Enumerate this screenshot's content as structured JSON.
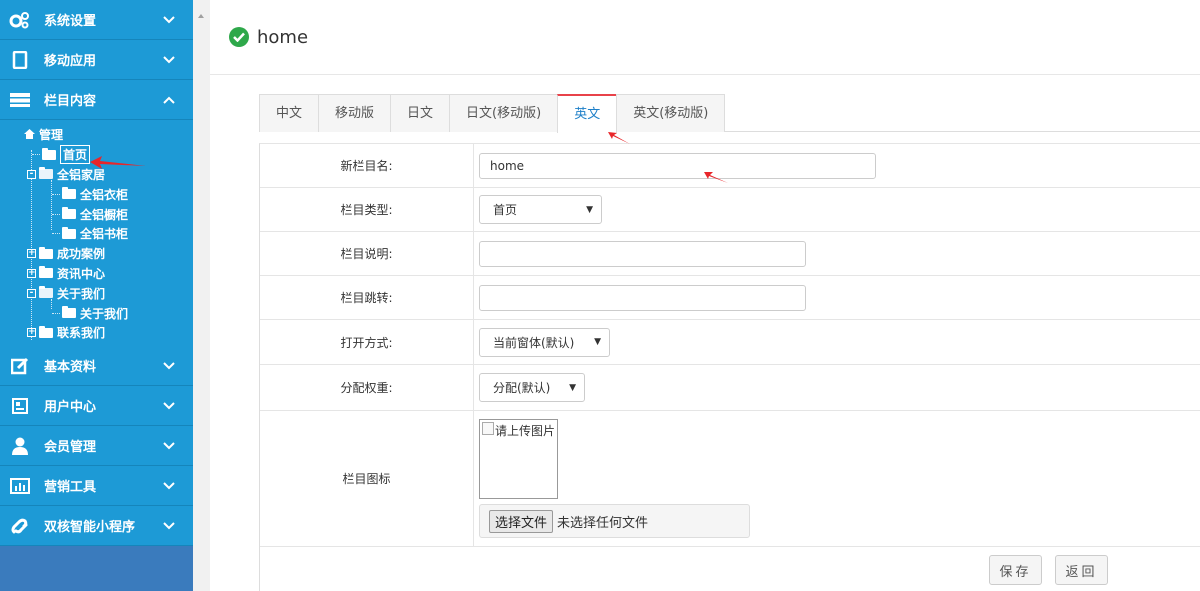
{
  "sidebar": {
    "menu": [
      {
        "label": "系统设置",
        "icon": "gears-icon",
        "state": "collapsed"
      },
      {
        "label": "移动应用",
        "icon": "tablet-icon",
        "state": "collapsed"
      },
      {
        "label": "栏目内容",
        "icon": "server-icon",
        "state": "expanded"
      }
    ],
    "tree": {
      "root": "管理",
      "items": [
        "首页",
        "全铝家居",
        "全铝衣柜",
        "全铝橱柜",
        "全铝书柜",
        "成功案例",
        "资讯中心",
        "关于我们",
        "关于我们",
        "联系我们"
      ]
    },
    "menu_bottom": [
      {
        "label": "基本资料",
        "icon": "edit-icon"
      },
      {
        "label": "用户中心",
        "icon": "id-card-icon"
      },
      {
        "label": "会员管理",
        "icon": "user-icon"
      },
      {
        "label": "营销工具",
        "icon": "bar-chart-icon"
      },
      {
        "label": "双核智能小程序",
        "icon": "mini-program-icon"
      }
    ]
  },
  "header": {
    "title": "home"
  },
  "tabs": [
    "中文",
    "移动版",
    "日文",
    "日文(移动版)",
    "英文",
    "英文(移动版)"
  ],
  "active_tab": "英文",
  "form": {
    "name_label": "新栏目名:",
    "name_value": "home",
    "type_label": "栏目类型:",
    "type_value": "首页",
    "desc_label": "栏目说明:",
    "desc_value": "",
    "jump_label": "栏目跳转:",
    "jump_value": "",
    "open_label": "打开方式:",
    "open_value": "当前窗体(默认)",
    "weight_label": "分配权重:",
    "weight_value": "分配(默认)",
    "icon_label": "栏目图标",
    "image_alt": "请上传图片",
    "file_button": "选择文件",
    "file_status": "未选择任何文件"
  },
  "buttons": {
    "save": "保存",
    "back": "返回"
  },
  "colors": {
    "sidebar_bg": "#1d9ad6",
    "accent": "#1d7fc8",
    "active_tab_border": "#e8424a",
    "check": "#2ea84a"
  }
}
